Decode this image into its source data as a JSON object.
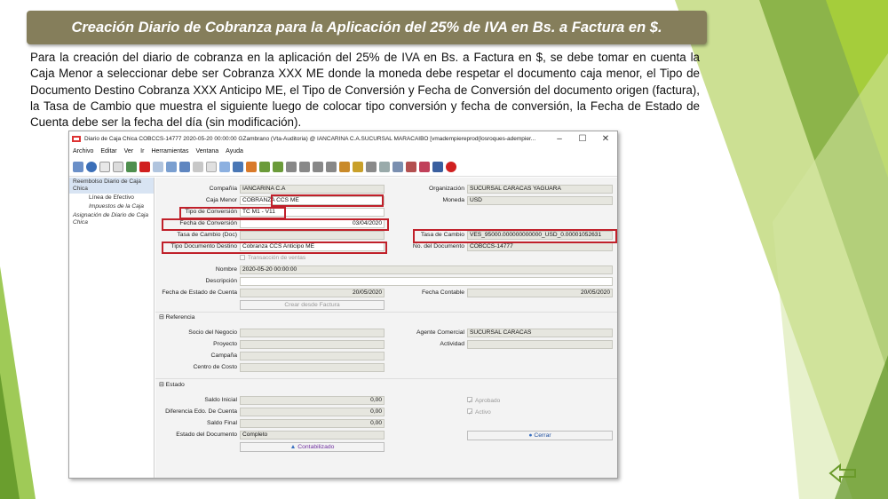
{
  "slide": {
    "title": "Creación Diario de Cobranza para la Aplicación del 25% de IVA en Bs. a Factura en $.",
    "paragraph": "Para la creación del diario de cobranza en la aplicación del 25% de IVA en Bs. a Factura en $, se debe tomar en cuenta la Caja Menor a seleccionar debe ser Cobranza XXX ME donde la moneda debe respetar el documento caja menor, el Tipo de Documento Destino Cobranza XXX Anticipo ME, el Tipo de Conversión y Fecha de Conversión del documento origen (factura), la Tasa de Cambio que muestra el siguiente luego de colocar tipo conversión y fecha de conversión, la Fecha de Estado de Cuenta debe ser la fecha del día (sin modificación)."
  },
  "window": {
    "title": "Diario de Caja Chica  COBCCS-14777  2020-05-20 00:00:00  GZambrano (Vta-Auditoria) @ IANCARINA C.A.SUCURSAL MARACAIBO [vmadempiereprod{losroques-adempier...",
    "minimize": "–",
    "maximize": "☐",
    "close": "✕",
    "menu": [
      "Archivo",
      "Editar",
      "Ver",
      "Ir",
      "Herramientas",
      "Ventana",
      "Ayuda"
    ]
  },
  "sidebar": [
    {
      "label": "Reembolso Diario de Caja Chica",
      "selected": true
    },
    {
      "label": "Línea de Efectivo"
    },
    {
      "label": "Impuestos de la Caja"
    },
    {
      "label": "Asignación de Diario de Caja Chica"
    }
  ],
  "form": {
    "compania_label": "Compañía",
    "compania": "IANCARINA C.A",
    "organizacion_label": "Organización",
    "organizacion": "SUCURSAL CARACAS YAGUARA",
    "caja_label": "Caja Menor",
    "caja": "COBRANZA CCS ME",
    "moneda_label": "Moneda",
    "moneda": "USD",
    "tipoconv_label": "Tipo de Conversión",
    "tipoconv": "TC M1 - V11",
    "fechaconv_label": "Fecha de Conversión",
    "fechaconv": "03/04/2020",
    "tasadoc_label": "Tasa de Cambio (Doc)",
    "tasa_label": "Tasa de Cambio",
    "tasa": "VES_95000.000000000000_USD_0.00001052631",
    "tipodoc_label": "Tipo Documento Destino",
    "tipodoc": "Cobranza CCS Anticipo ME",
    "nodoc_label": "No. del Documento",
    "nodoc": "COBCCS-14777",
    "transaccion": "Transacción de ventas",
    "nombre_label": "Nombre",
    "nombre": "2020-05-20 00:00:00",
    "descripcion_label": "Descripción",
    "fechaedo_label": "Fecha de Estado de Cuenta",
    "fechaedo": "20/05/2020",
    "fechacont_label": "Fecha Contable",
    "fechacont": "20/05/2020",
    "crear_btn": "Crear desde Factura"
  },
  "referencia": {
    "title": "Referencia",
    "socio_label": "Socio del Negocio",
    "agente_label": "Agente Comercial",
    "agente": "SUCURSAL CARACAS",
    "proyecto_label": "Proyecto",
    "actividad_label": "Actividad",
    "campana_label": "Campaña",
    "centro_label": "Centro de Costo"
  },
  "estado": {
    "title": "Estado",
    "saldoini_label": "Saldo Inicial",
    "saldoini": "0,00",
    "aprobado": "Aprobado",
    "diferencia_label": "Diferencia Edo. De Cuenta",
    "diferencia": "0,00",
    "activo": "Activo",
    "saldofin_label": "Saldo Final",
    "saldofin": "0,00",
    "estadodoc_label": "Estado del Documento",
    "estadodoc": "Completo",
    "cerrar_btn": "Cerrar",
    "contab_btn": "Contabilizado"
  },
  "colors": {
    "title_bg": "#857e5b",
    "highlight": "#c0202a",
    "green_light": "#a7cf3a",
    "green_dark": "#5d9224"
  }
}
